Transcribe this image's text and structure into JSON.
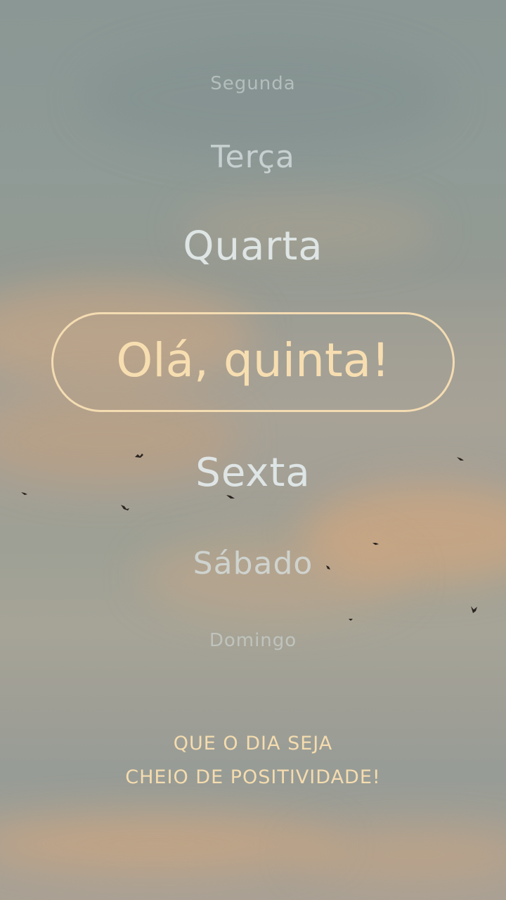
{
  "days": {
    "monday": "Segunda",
    "tuesday": "Terça",
    "wednesday": "Quarta",
    "thursday_greeting": "Olá, quinta!",
    "friday": "Sexta",
    "saturday": "Sábado",
    "sunday": "Domingo"
  },
  "message": {
    "line1": "QUE O DIA SEJA",
    "line2": "CHEIO DE POSITIVIDADE!"
  },
  "colors": {
    "highlight": "#f7deb1",
    "sky": "#9ea095",
    "cloud_glow": "#d9a77e"
  }
}
